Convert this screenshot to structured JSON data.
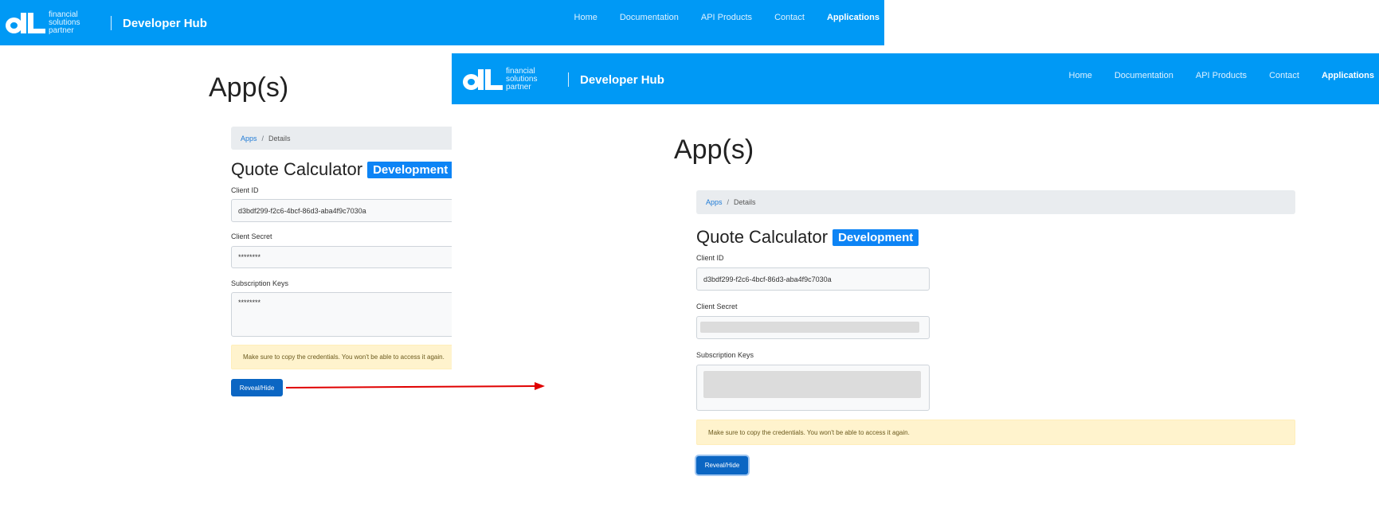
{
  "brand": {
    "tagline_line1": "financial solutions",
    "tagline_line2": "partner",
    "title": "Developer Hub"
  },
  "nav": {
    "items": [
      "Home",
      "Documentation",
      "API Products",
      "Contact",
      "Applications"
    ],
    "active": "Applications"
  },
  "page_title": "App(s)",
  "breadcrumb": {
    "link": "Apps",
    "separator": "/",
    "current": "Details"
  },
  "app": {
    "name": "Quote Calculator",
    "environment": "Development"
  },
  "fields": {
    "client_id_label": "Client ID",
    "client_id_value": "d3bdf299-f2c6-4bcf-86d3-aba4f9c7030a",
    "client_secret_label": "Client Secret",
    "client_secret_masked": "********",
    "subscription_keys_label": "Subscription Keys",
    "subscription_keys_masked": "********"
  },
  "alert_text": "Make sure to copy the credentials. You won't be able to access it again.",
  "button_label": "Reveal/Hide",
  "colors": {
    "navbar": "#0099f5",
    "badge": "#0d84f5",
    "button": "#0b66c3",
    "alert_bg": "#fff3cd",
    "arrow": "#e00000"
  }
}
